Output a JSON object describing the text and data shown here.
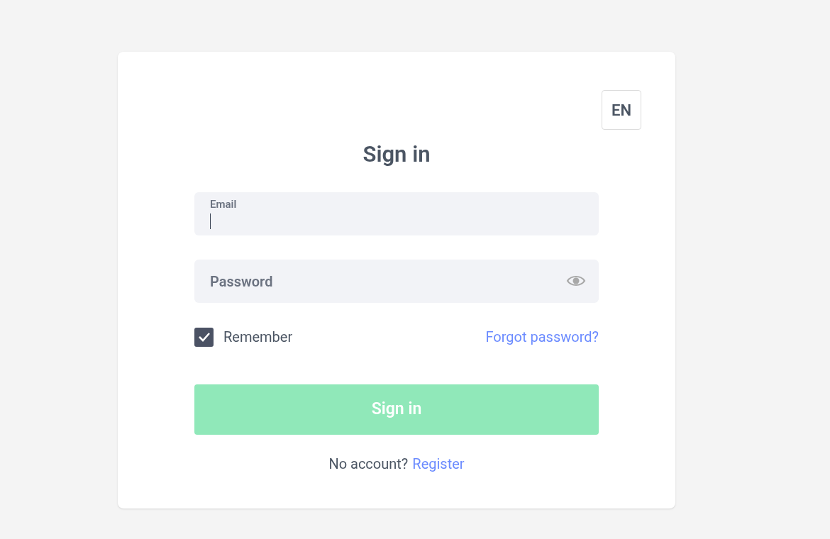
{
  "language_button": "EN",
  "title": "Sign in",
  "email": {
    "label": "Email",
    "focused": true
  },
  "password": {
    "placeholder": "Password"
  },
  "remember": {
    "label": "Remember",
    "checked": true
  },
  "forgot_link": "Forgot password?",
  "submit": {
    "label": "Sign in",
    "disabled": true
  },
  "register": {
    "prompt": "No account?",
    "link": "Register"
  }
}
